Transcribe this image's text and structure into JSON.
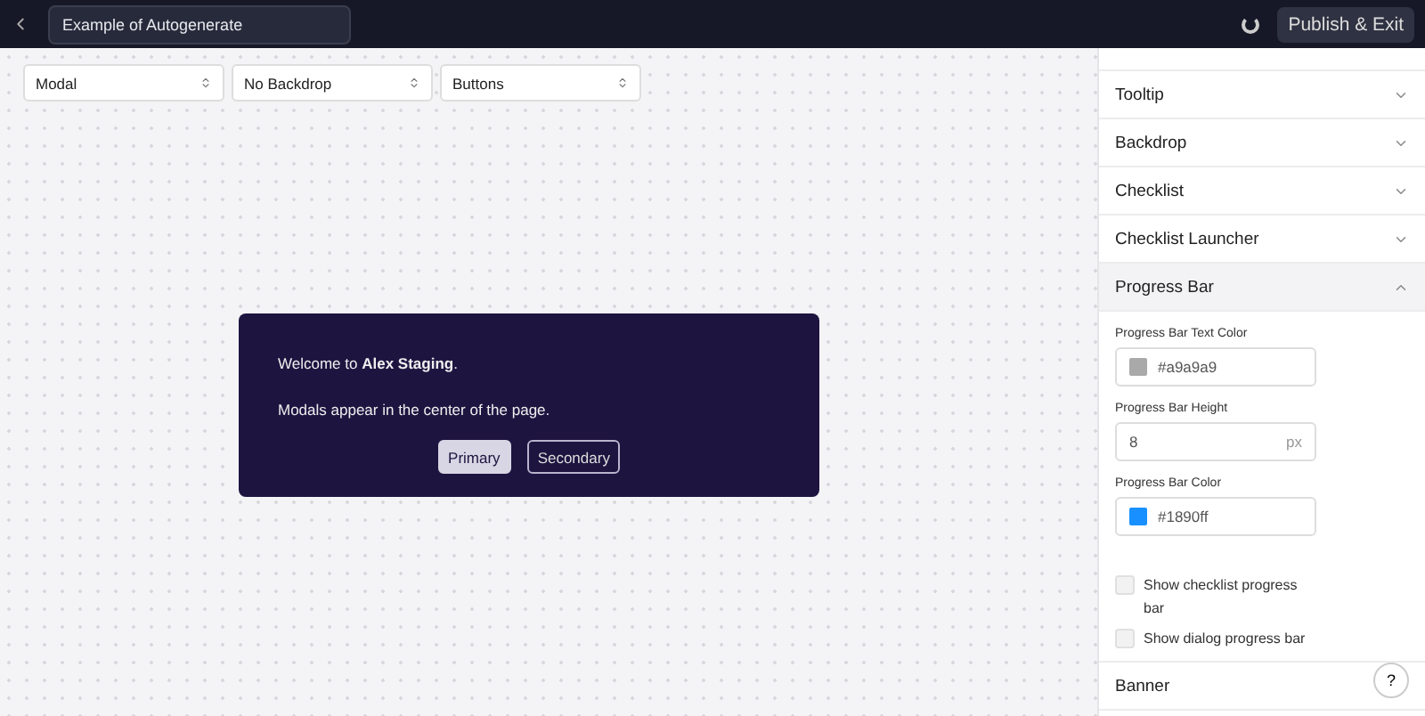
{
  "topbar": {
    "title": "Example of Autogenerate",
    "publish": "Publish & Exit"
  },
  "selects": [
    {
      "value": "Modal"
    },
    {
      "value": "No Backdrop"
    },
    {
      "value": "Buttons"
    }
  ],
  "modal": {
    "text": "Welcome to **Alex Staging**.",
    "body": "Modals appear in the center of the page.",
    "buttons": [
      {
        "label": "Primary",
        "kind": "primary"
      },
      {
        "label": "Secondary",
        "kind": "secondary"
      }
    ]
  },
  "panel": {
    "sections": [
      {
        "label": "Tooltip",
        "expanded": false
      },
      {
        "label": "Backdrop",
        "expanded": false
      },
      {
        "label": "Checklist",
        "expanded": false
      },
      {
        "label": "Checklist Launcher",
        "expanded": false
      },
      {
        "label": "Progress Bar",
        "expanded": true
      }
    ],
    "fields": [
      {
        "kind": "color",
        "label": "Progress Bar Text Color",
        "value": "#a9a9a9",
        "color": "#a9a9a9"
      },
      {
        "kind": "number",
        "label": "Progress Bar Height",
        "value": "8",
        "unit": "px"
      },
      {
        "kind": "color",
        "label": "Progress Bar Color",
        "value": "#1890ff",
        "color": "#1890ff"
      }
    ],
    "checks": [
      {
        "label": "Show checklist progress bar",
        "checked": false
      },
      {
        "label": "Show dialog progress bar",
        "checked": false
      }
    ],
    "after": [
      {
        "label": "Banner",
        "expanded": false
      }
    ]
  },
  "help": "?"
}
